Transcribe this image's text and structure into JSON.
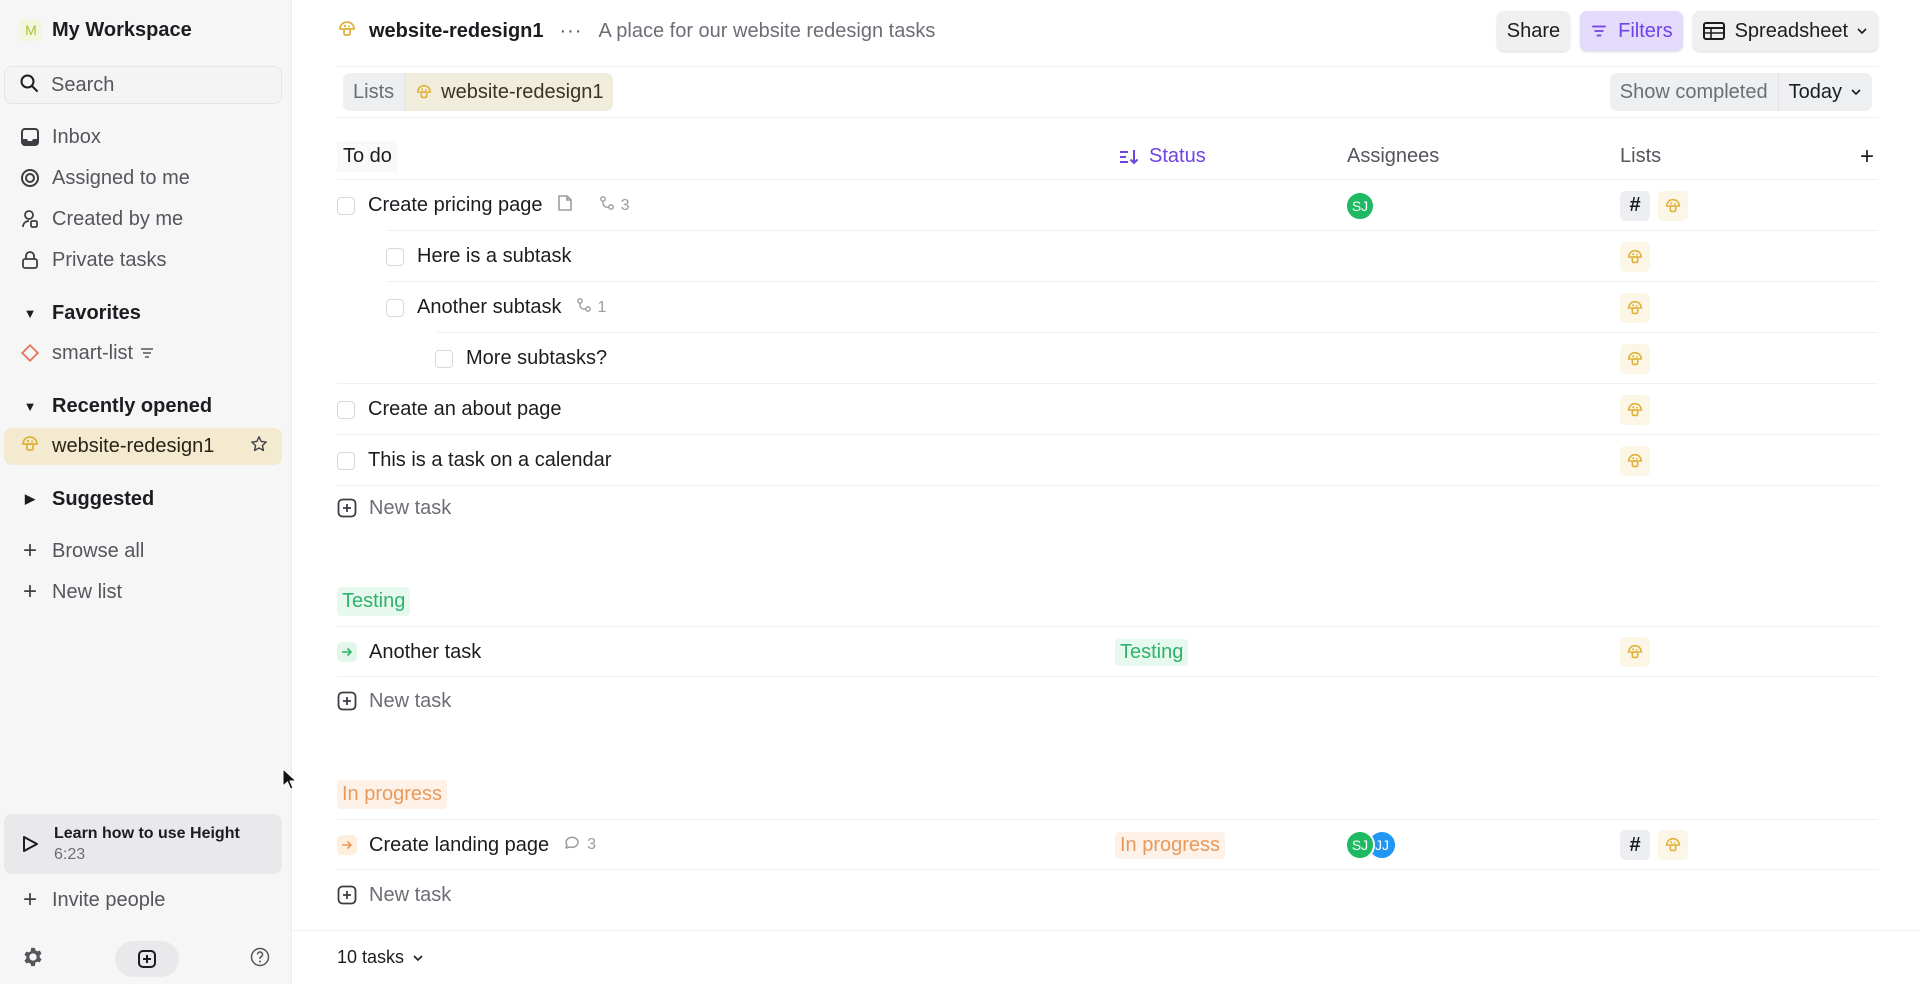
{
  "workspace": {
    "badge": "M",
    "name": "My Workspace"
  },
  "sidebar": {
    "search_placeholder": "Search",
    "nav": [
      {
        "icon": "inbox-icon",
        "label": "Inbox"
      },
      {
        "icon": "target-icon",
        "label": "Assigned to me"
      },
      {
        "icon": "user-created-icon",
        "label": "Created by me"
      },
      {
        "icon": "lock-icon",
        "label": "Private tasks"
      }
    ],
    "favorites": {
      "label": "Favorites",
      "items": [
        {
          "icon": "diamond-icon",
          "label": "smart-list"
        }
      ]
    },
    "recent": {
      "label": "Recently opened",
      "items": [
        {
          "icon": "mushroom-icon",
          "label": "website-redesign1"
        }
      ]
    },
    "suggested": {
      "label": "Suggested"
    },
    "browse_all": "Browse all",
    "new_list": "New list",
    "learn": {
      "title": "Learn how to use Height",
      "duration": "6:23"
    },
    "invite": "Invite people"
  },
  "header": {
    "title": "website-redesign1",
    "description": "A place for our website redesign tasks",
    "share": "Share",
    "filters": "Filters",
    "view": "Spreadsheet"
  },
  "toolbar": {
    "crumbs": [
      "Lists",
      "website-redesign1"
    ],
    "show_completed": "Show completed",
    "date": "Today"
  },
  "columns": {
    "todo": "To do",
    "status": "Status",
    "assignees": "Assignees",
    "lists": "Lists"
  },
  "colors": {
    "accent": "#6e44e4",
    "testing": "#2fb36b",
    "in_progress": "#e89a5c",
    "avatar_sj": "#1fb863",
    "avatar_jj": "#2196f3"
  },
  "groups": {
    "todo": {
      "tasks": [
        {
          "name": "Create pricing page",
          "doc": true,
          "subtasks": "3",
          "assignees": [
            "SJ"
          ],
          "lists": [
            "hash",
            "shroom"
          ]
        },
        {
          "name": "Here is a subtask",
          "lists": [
            "shroom"
          ]
        },
        {
          "name": "Another subtask",
          "subtasks": "1",
          "lists": [
            "shroom"
          ]
        },
        {
          "name": "More subtasks?",
          "lists": [
            "shroom"
          ]
        },
        {
          "name": "Create an about page",
          "lists": [
            "shroom"
          ]
        },
        {
          "name": "This is a task on a calendar",
          "lists": [
            "shroom"
          ]
        }
      ],
      "new_task": "New task"
    },
    "testing": {
      "label": "Testing",
      "tasks": [
        {
          "name": "Another task",
          "status": "Testing",
          "lists": [
            "shroom"
          ]
        }
      ],
      "new_task": "New task"
    },
    "in_progress": {
      "label": "In progress",
      "tasks": [
        {
          "name": "Create landing page",
          "comments": "3",
          "status": "In progress",
          "assignees": [
            "SJ",
            "JJ"
          ],
          "lists": [
            "hash",
            "shroom"
          ]
        }
      ],
      "new_task": "New task"
    }
  },
  "footer": {
    "count": "10 tasks"
  }
}
